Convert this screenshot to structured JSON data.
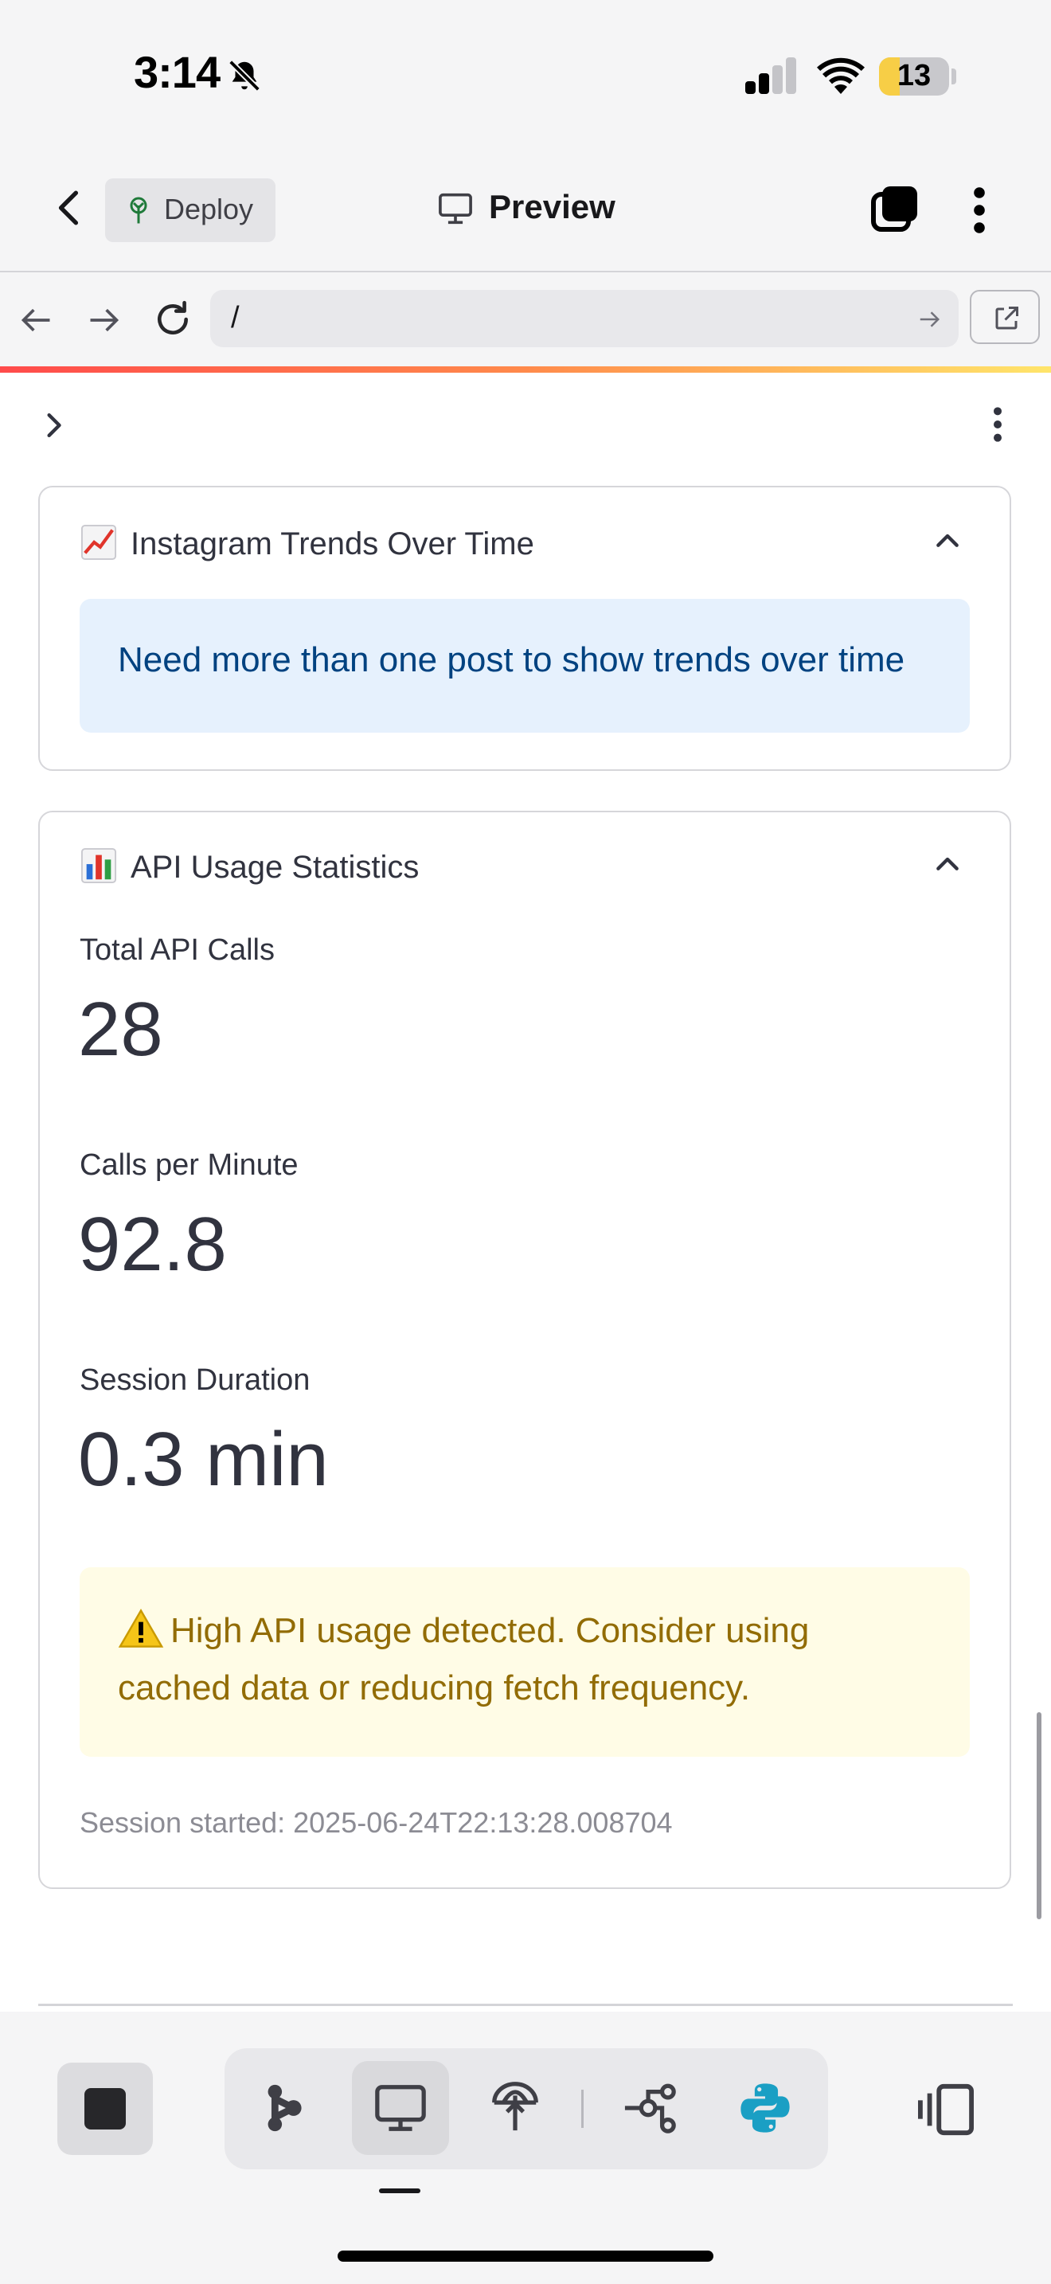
{
  "status_bar": {
    "time": "3:14",
    "battery": "13"
  },
  "header": {
    "deploy_label": "Deploy",
    "title": "Preview"
  },
  "url_bar": {
    "value": "/"
  },
  "trends_card": {
    "title": "Instagram Trends Over Time",
    "info_message": "Need more than one post to show trends over time"
  },
  "api_card": {
    "title": "API Usage Statistics",
    "metrics": [
      {
        "label": "Total API Calls",
        "value": "28"
      },
      {
        "label": "Calls per Minute",
        "value": "92.8"
      },
      {
        "label": "Session Duration",
        "value": "0.3 min"
      }
    ],
    "warning": "High API usage detected. Consider using cached data or reducing fetch frequency.",
    "session_started": "Session started: 2025-06-24T22:13:28.008704"
  },
  "colors": {
    "info_bg": "#e6f1fd",
    "info_text": "#004280",
    "warning_bg": "#fffce6",
    "warning_text": "#926c05",
    "python_accent": "#1a9fc4"
  },
  "icons": {
    "status": [
      "mute-bell-icon",
      "signal-icon",
      "wifi-icon",
      "battery-icon"
    ],
    "header": [
      "back-chevron-icon",
      "deploy-tree-icon",
      "monitor-icon",
      "tabs-icon",
      "more-vertical-icon"
    ],
    "url_bar": [
      "arrow-left-icon",
      "arrow-right-icon",
      "reload-icon",
      "go-arrow-icon",
      "open-external-icon"
    ],
    "toolbar": [
      "stop-icon",
      "agent-icon",
      "preview-icon",
      "deploy-icon",
      "git-branch-icon",
      "python-icon",
      "layout-icon"
    ]
  }
}
